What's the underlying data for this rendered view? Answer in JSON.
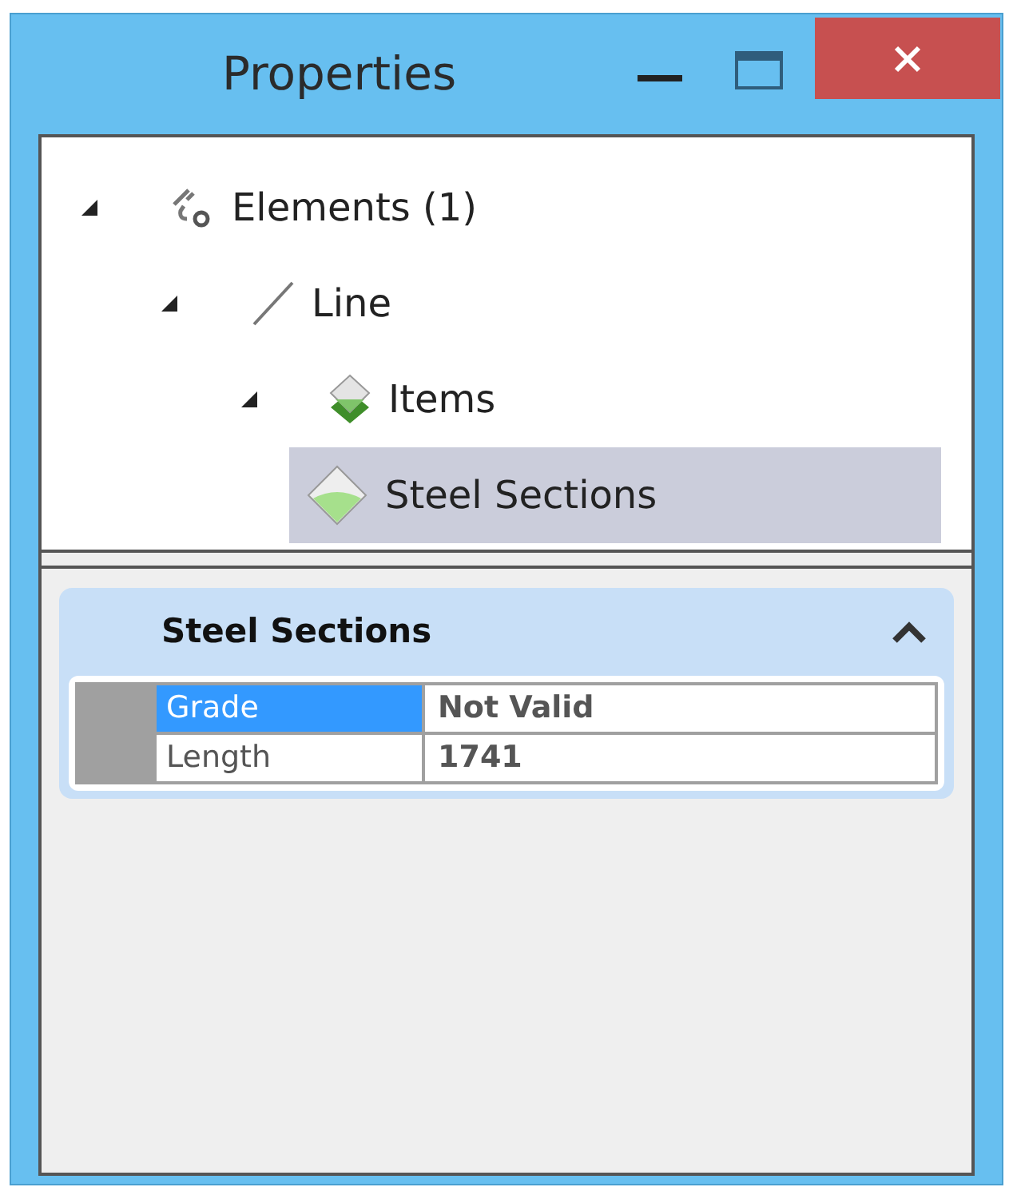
{
  "window": {
    "title": "Properties"
  },
  "tree": [
    {
      "label": "Elements (1)",
      "kind": "elements",
      "expanded": true,
      "selected": false,
      "children": [
        {
          "label": "Line",
          "kind": "line",
          "expanded": true,
          "selected": false,
          "children": [
            {
              "label": "Items",
              "kind": "items",
              "expanded": true,
              "selected": false,
              "children": [
                {
                  "label": "Steel Sections",
                  "kind": "section",
                  "selected": true
                }
              ]
            }
          ]
        }
      ]
    }
  ],
  "section": {
    "title": "Steel Sections",
    "expanded": true,
    "rows": [
      {
        "name": "Grade",
        "value": "Not Valid",
        "selected": true
      },
      {
        "name": "Length",
        "value": "1741",
        "selected": false
      }
    ]
  }
}
